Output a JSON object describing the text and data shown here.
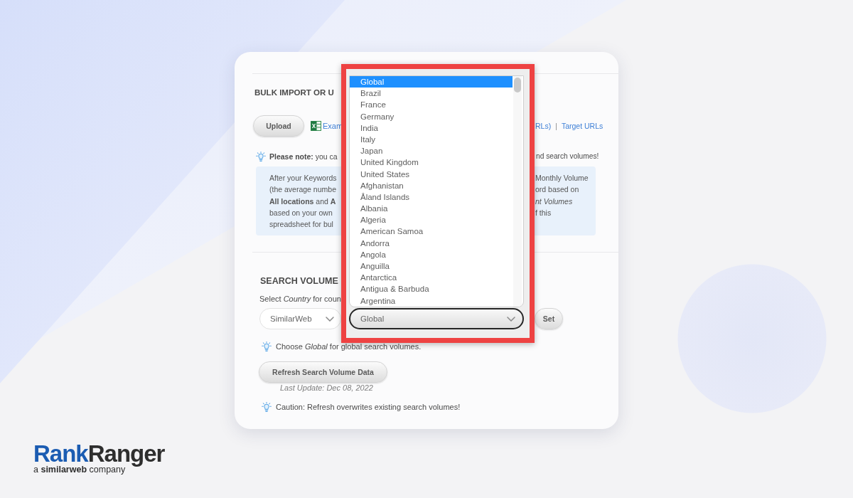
{
  "bulk_import": {
    "heading": "BULK IMPORT OR U",
    "upload_button": "Upload",
    "example_link": "Exam",
    "partial_link": "RLs)",
    "separator": "|",
    "target_urls_link": "Target URLs",
    "note": {
      "left": "**Please note:** you ca",
      "right": "nd search volumes!"
    },
    "info_box": {
      "left_lines": [
        "After your Keywords",
        "(the average numbe",
        "**All locations** and **A**",
        "based on your own",
        "spreadsheet for bul"
      ],
      "right_lines": [
        "Monthly Volume",
        "ord based on",
        "*nt Volumes*",
        "f this"
      ]
    }
  },
  "search_volume": {
    "heading": "SEARCH VOLUME",
    "instruction": "Select *Country* for coun",
    "source_select": {
      "value": "SimilarWeb"
    },
    "set_button": "Set",
    "tip": "Choose *Global* for global search volumes.",
    "refresh_button": "Refresh Search Volume Data",
    "last_update": "Last Update: Dec 08, 2022",
    "caution": "Caution: Refresh overwrites existing search volumes!"
  },
  "country_dropdown": {
    "value": "Global",
    "expanded": true,
    "options": [
      {
        "label": "Global",
        "selected": true
      },
      {
        "label": "Brazil",
        "selected": false
      },
      {
        "label": "France",
        "selected": false
      },
      {
        "label": "Germany",
        "selected": false
      },
      {
        "label": "India",
        "selected": false
      },
      {
        "label": "Italy",
        "selected": false
      },
      {
        "label": "Japan",
        "selected": false
      },
      {
        "label": "United Kingdom",
        "selected": false
      },
      {
        "label": "United States",
        "selected": false
      },
      {
        "label": "Afghanistan",
        "selected": false
      },
      {
        "label": "Åland Islands",
        "selected": false
      },
      {
        "label": "Albania",
        "selected": false
      },
      {
        "label": "Algeria",
        "selected": false
      },
      {
        "label": "American Samoa",
        "selected": false
      },
      {
        "label": "Andorra",
        "selected": false
      },
      {
        "label": "Angola",
        "selected": false
      },
      {
        "label": "Anguilla",
        "selected": false
      },
      {
        "label": "Antarctica",
        "selected": false
      },
      {
        "label": "Antigua & Barbuda",
        "selected": false
      },
      {
        "label": "Argentina",
        "selected": false
      }
    ]
  },
  "logo": {
    "wordmark_first": "Rank",
    "wordmark_second": "Ranger",
    "tagline": "a **similarweb** company"
  }
}
